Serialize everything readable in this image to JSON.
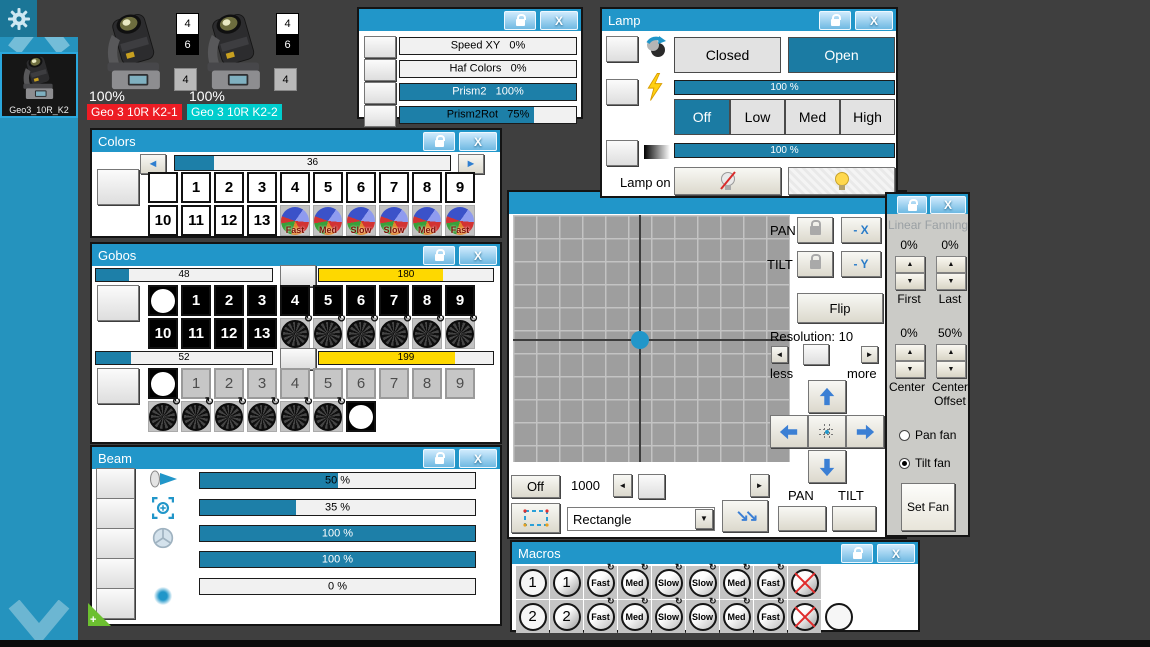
{
  "palette": {
    "titlebar": "#2196c9",
    "slider_fill": "#1d7fa8",
    "slider_yellow": "#fed800",
    "sidebar": "#2593be",
    "chip_red": "#ed1c24",
    "chip_cyan": "#00cdcd"
  },
  "sidebar": {
    "thumb_label": "Geo3_10R_K2"
  },
  "fixtures": [
    {
      "intensity": "100%",
      "name": "Geo 3 10R K2-1",
      "badges": [
        "4",
        "6",
        "4"
      ]
    },
    {
      "intensity": "100%",
      "name": "Geo 3 10R K2-2",
      "badges": [
        "4",
        "6",
        "4"
      ]
    }
  ],
  "presets_panel": {
    "rows": [
      {
        "label": "Speed XY",
        "value": "0%",
        "fill": 0
      },
      {
        "label": "Haf Colors",
        "value": "0%",
        "fill": 0
      },
      {
        "label": "Prism2",
        "value": "100%",
        "fill": 100
      },
      {
        "label": "Prism2Rot",
        "value": "75%",
        "fill": 76
      }
    ]
  },
  "lamp_panel": {
    "title": "Lamp",
    "closed": "Closed",
    "open": "Open",
    "strobe_value": "100 %",
    "strobe_fill": 100,
    "modes": [
      "Off",
      "Low",
      "Med",
      "High"
    ],
    "dimmer_value": "100 %",
    "dimmer_fill": 100,
    "lamp_on_label": "Lamp on"
  },
  "colors_panel": {
    "title": "Colors",
    "wheel_value": "36",
    "wheel_fill": 14,
    "slots_a": [
      "1",
      "2",
      "3",
      "4",
      "5",
      "6",
      "7",
      "8",
      "9"
    ],
    "slots_b": [
      "10",
      "11",
      "12",
      "13"
    ],
    "speeds": [
      "Fast",
      "Med",
      "Slow",
      "Slow",
      "Med",
      "Fast"
    ]
  },
  "gobos_panel": {
    "title": "Gobos",
    "wheel1_value": "48",
    "wheel1_fill": 19,
    "rot1_value": "180",
    "rot1_fill": 71,
    "slots1": [
      "1",
      "2",
      "3",
      "4",
      "5",
      "6",
      "7",
      "8",
      "9"
    ],
    "slots1b": [
      "10",
      "11",
      "12",
      "13"
    ],
    "wheel2_value": "52",
    "wheel2_fill": 20,
    "rot2_value": "199",
    "rot2_fill": 78,
    "slots2": [
      "1",
      "2",
      "3",
      "4",
      "5",
      "6",
      "7",
      "8",
      "9"
    ]
  },
  "beam_panel": {
    "title": "Beam",
    "sliders": [
      {
        "value": "50 %",
        "fill": 50
      },
      {
        "value": "35 %",
        "fill": 35
      },
      {
        "value": "100 %",
        "fill": 100
      },
      {
        "value": "100 %",
        "fill": 100
      },
      {
        "value": "0 %",
        "fill": 0
      }
    ]
  },
  "xy_panel": {
    "pan": "PAN",
    "tilt": "TILT",
    "minus_x": "- X",
    "minus_y": "- Y",
    "flip": "Flip",
    "resolution": "Resolution: 10",
    "less": "less",
    "more": "more",
    "off": "Off",
    "interval": "1000",
    "shape": "Rectangle",
    "pan2": "PAN",
    "tilt2": "TILT"
  },
  "fanning_panel": {
    "title": "Linear Fanning",
    "first_value": "0%",
    "last_value": "0%",
    "first": "First",
    "last": "Last",
    "center_value": "0%",
    "offset_value": "50%",
    "center_a": "Center",
    "center_b": "Center",
    "offset": "Offset",
    "pan_fan": "Pan fan",
    "tilt_fan": "Tilt fan",
    "set_fan": "Set Fan"
  },
  "macros_panel": {
    "title": "Macros",
    "row1_num": "1",
    "row2_num": "2",
    "speeds": [
      "Fast",
      "Med",
      "Slow",
      "Slow",
      "Med",
      "Fast"
    ]
  }
}
